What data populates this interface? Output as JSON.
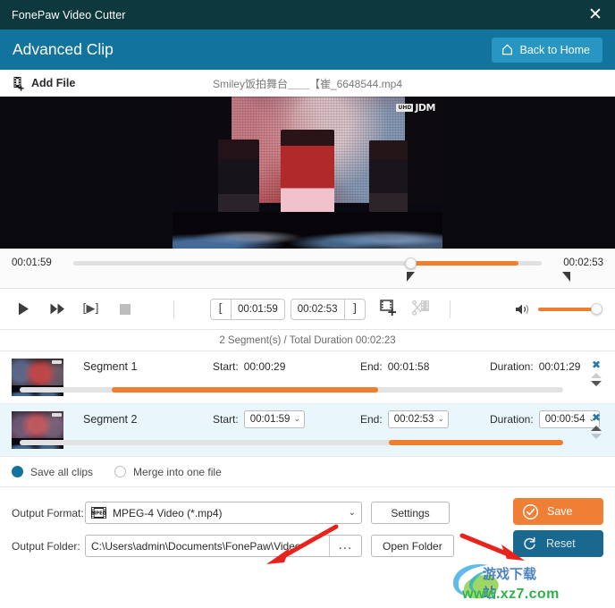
{
  "window": {
    "title": "FonePaw Video Cutter",
    "close_icon": "close-icon"
  },
  "subheader": {
    "title": "Advanced Clip",
    "back_home_label": "Back to Home",
    "home_icon": "home-icon"
  },
  "file_row": {
    "add_file_label": "Add File",
    "add_file_icon": "film-plus-icon",
    "filename": "Smiley饭拍舞台＿＿【崔_6648544.mp4"
  },
  "preview": {
    "badge_uhd": "UHD",
    "badge_jdm": "JDM"
  },
  "timeline": {
    "current_time": "00:01:59",
    "end_time": "00:02:53",
    "playhead_percent": 72,
    "fill_percent": 72,
    "in_marker_percent": 71,
    "out_marker_percent": 101
  },
  "controls": {
    "play_icon": "play-icon",
    "forward_icon": "fast-forward-icon",
    "frame_step_icon": "frame-step-icon",
    "frame_step_glyph": "[▶]",
    "stop_icon": "stop-icon",
    "in_bracket": "[",
    "out_bracket": "]",
    "start_time": "00:01:59",
    "end_time": "00:02:53",
    "add_segment_icon": "add-segment-icon",
    "split_segment_icon": "split-segment-icon",
    "volume_icon": "volume-icon",
    "volume_percent": 100
  },
  "segments_header": "2 Segment(s) / Total Duration 00:02:23",
  "segment_labels": {
    "start": "Start:",
    "end": "End:",
    "duration": "Duration:"
  },
  "segments": [
    {
      "name": "Segment 1",
      "start": "00:00:29",
      "end": "00:01:58",
      "duration": "00:01:29",
      "editable": false,
      "selected": false,
      "bar_start_percent": 17,
      "bar_end_percent": 66,
      "move_up_enabled": false,
      "move_down_enabled": true,
      "remove_icon": "close-icon"
    },
    {
      "name": "Segment 2",
      "start": "00:01:59",
      "end": "00:02:53",
      "duration": "00:00:54",
      "editable": true,
      "selected": true,
      "bar_start_percent": 68,
      "bar_end_percent": 100,
      "move_up_enabled": true,
      "move_down_enabled": false,
      "remove_icon": "close-icon"
    }
  ],
  "save_mode": {
    "options": [
      {
        "label": "Save all clips",
        "selected": true
      },
      {
        "label": "Merge into one file",
        "selected": false
      }
    ]
  },
  "output": {
    "format_label": "Output Format:",
    "format_value": "MPEG-4 Video (*.mp4)",
    "format_icon": "mpeg-film-icon",
    "settings_label": "Settings",
    "folder_label": "Output Folder:",
    "folder_value": "C:\\Users\\admin\\Documents\\FonePaw\\Video",
    "browse_label": "...",
    "open_folder_label": "Open Folder",
    "save_label": "Save",
    "save_icon": "check-circle-icon",
    "reset_label": "Reset",
    "reset_icon": "refresh-icon"
  },
  "watermark": {
    "url": "www.xz7.com",
    "cn_text": "游戏下载站"
  },
  "colors": {
    "titlebar": "#0c383e",
    "subheader": "#12749c",
    "accent_orange": "#ef7f2e",
    "accent_teal": "#2796c2",
    "selected_row": "#e9f7fc",
    "save_button": "#ef7f35",
    "reset_button": "#18688f"
  }
}
